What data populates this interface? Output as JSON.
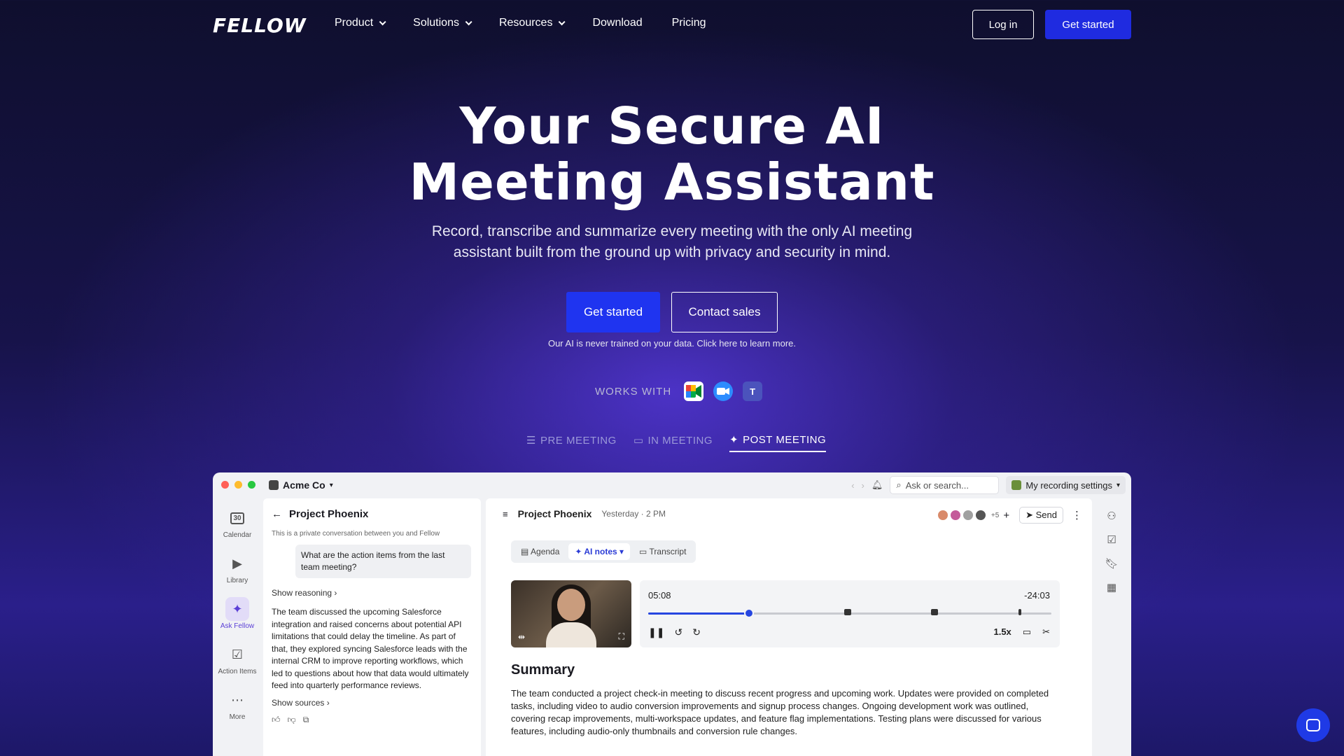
{
  "nav": {
    "logo": "FELLOW",
    "links": [
      {
        "label": "Product",
        "dropdown": true
      },
      {
        "label": "Solutions",
        "dropdown": true
      },
      {
        "label": "Resources",
        "dropdown": true
      },
      {
        "label": "Download",
        "dropdown": false
      },
      {
        "label": "Pricing",
        "dropdown": false
      }
    ],
    "login": "Log in",
    "get_started": "Get started"
  },
  "hero": {
    "title_line1": "Your Secure AI",
    "title_line2": "Meeting Assistant",
    "subtitle": "Record, transcribe and summarize every meeting with the only AI meeting assistant built from the ground up with privacy and security in mind.",
    "cta_primary": "Get started",
    "cta_secondary": "Contact sales",
    "note": "Our AI is never trained on your data. Click here to learn more.",
    "works_with": "WORKS WITH",
    "integrations": [
      "google-meet-icon",
      "zoom-icon",
      "teams-icon"
    ]
  },
  "tabs": [
    {
      "label": "PRE MEETING",
      "icon": "list-icon",
      "active": false
    },
    {
      "label": "IN MEETING",
      "icon": "message-icon",
      "active": false
    },
    {
      "label": "POST MEETING",
      "icon": "sparkle-icon",
      "active": true
    }
  ],
  "app": {
    "workspace": "Acme Co",
    "search_placeholder": "Ask or search...",
    "recording_settings": "My recording settings",
    "sidebar": [
      {
        "label": "Calendar",
        "icon": "calendar-icon",
        "active": false
      },
      {
        "label": "Library",
        "icon": "library-icon",
        "active": false
      },
      {
        "label": "Ask Fellow",
        "icon": "ask-fellow-icon",
        "active": true
      },
      {
        "label": "Action Items",
        "icon": "checkbox-icon",
        "active": false
      },
      {
        "label": "More",
        "icon": "more-icon",
        "active": false
      }
    ],
    "chat": {
      "title": "Project Phoenix",
      "private_note": "This is a private conversation between you and Fellow",
      "question": "What are the action items from the last team meeting?",
      "show_reasoning": "Show reasoning",
      "answer": "The team discussed the upcoming Salesforce integration and raised concerns about potential API limitations that could delay the timeline. As part of that, they explored syncing Salesforce leads with the internal CRM to improve reporting workflows, which led to questions about how that data would ultimately feed into quarterly performance reviews.",
      "show_sources": "Show sources"
    },
    "meeting": {
      "title": "Project Phoenix",
      "date": "Yesterday · 2 PM",
      "attendee_extra": "+5",
      "send": "Send",
      "segments": [
        {
          "label": "Agenda",
          "active": false
        },
        {
          "label": "AI notes",
          "active": true
        },
        {
          "label": "Transcript",
          "active": false
        }
      ],
      "player": {
        "current": "05:08",
        "remaining": "-24:03",
        "speed": "1.5x",
        "progress_fraction": 0.25
      },
      "summary_heading": "Summary",
      "summary_text": "The team conducted a project check-in meeting to discuss recent progress and upcoming work. Updates were provided on completed tasks, including video to audio conversion improvements and signup process changes. Ongoing development work was outlined, covering recap improvements, multi-workspace updates, and feature flag implementations. Testing plans were discussed for various features, including audio-only thumbnails and conversion rule changes."
    }
  },
  "colors": {
    "accent": "#1f34f0",
    "ask_fellow": "#5b3fd6",
    "progress": "#2646e0"
  }
}
